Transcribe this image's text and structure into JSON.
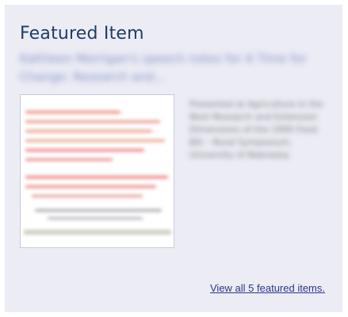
{
  "widget": {
    "title": "Featured Item",
    "item_title": "Kathleen Merrigan's speech notes for A Time for Change: Research and...",
    "thumbnail_alt": "Featured item thumbnail",
    "description": "Presented at Agriculture in the Next Research and Extension Dimensions of the 1990 Food Bill – Rural Symposium, University of Nebraska.",
    "view_all_label": "View all 5 featured items."
  },
  "colors": {
    "panel_background": "#ebecf4",
    "title": "#1f3d63",
    "link": "#2b3590",
    "thumbnail_ink": "#e85a5a"
  }
}
